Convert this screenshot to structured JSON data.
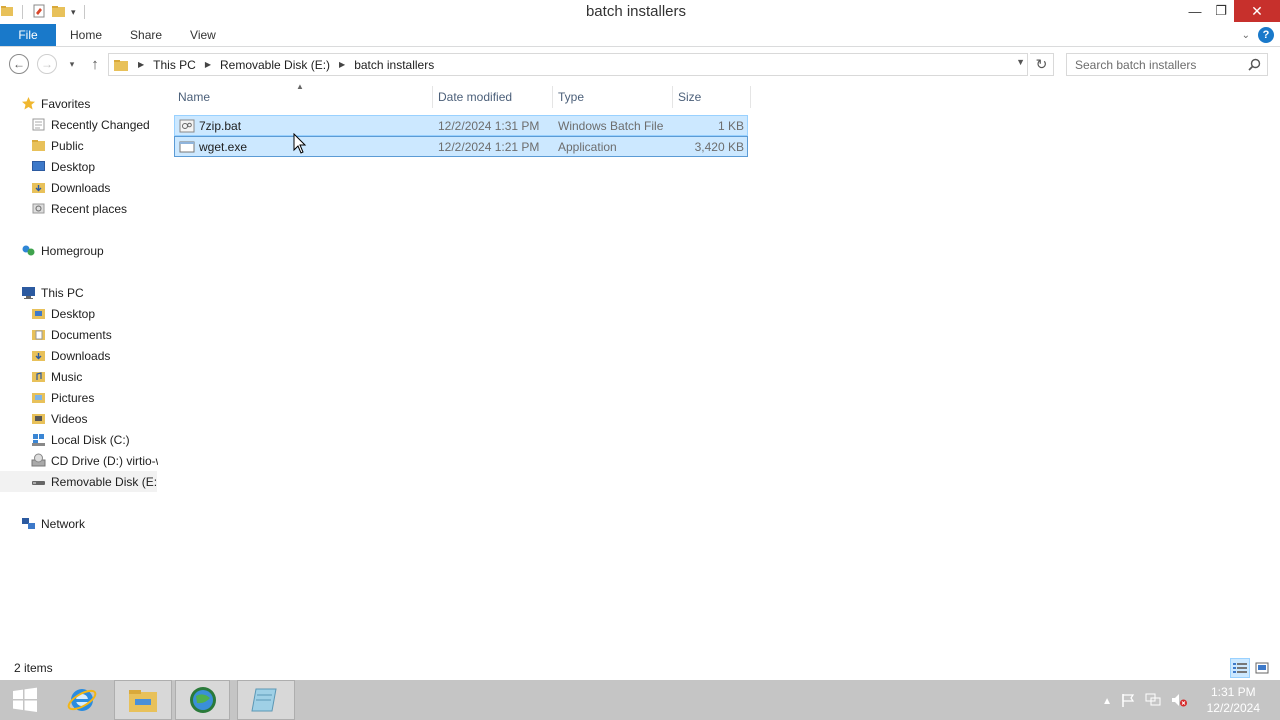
{
  "window": {
    "title": "batch installers",
    "minimize": "—",
    "restore": "❐",
    "close": "✕"
  },
  "ribbon": {
    "tabs": [
      {
        "label": "File"
      },
      {
        "label": "Home"
      },
      {
        "label": "Share"
      },
      {
        "label": "View"
      }
    ]
  },
  "address": {
    "crumbs": [
      "This PC",
      "Removable Disk (E:)",
      "batch installers"
    ]
  },
  "search": {
    "placeholder": "Search batch installers"
  },
  "nav": {
    "favorites": "Favorites",
    "favorites_items": [
      "Recently Changed",
      "Public",
      "Desktop",
      "Downloads",
      "Recent places"
    ],
    "homegroup": "Homegroup",
    "this_pc": "This PC",
    "this_pc_items": [
      "Desktop",
      "Documents",
      "Downloads",
      "Music",
      "Pictures",
      "Videos",
      "Local Disk (C:)",
      "CD Drive (D:) virtio-win",
      "Removable Disk (E:)"
    ],
    "network": "Network"
  },
  "columns": {
    "name": "Name",
    "date": "Date modified",
    "type": "Type",
    "size": "Size"
  },
  "files": [
    {
      "name": "7zip.bat",
      "date": "12/2/2024 1:31 PM",
      "type": "Windows Batch File",
      "size": "1 KB"
    },
    {
      "name": "wget.exe",
      "date": "12/2/2024 1:21 PM",
      "type": "Application",
      "size": "3,420 KB"
    }
  ],
  "status": {
    "count": "2 items"
  },
  "clock": {
    "time": "1:31 PM",
    "date": "12/2/2024"
  },
  "colors": {
    "accent": "#1979ca",
    "selection": "#cce8ff",
    "taskbar": "#c5c5c5"
  }
}
